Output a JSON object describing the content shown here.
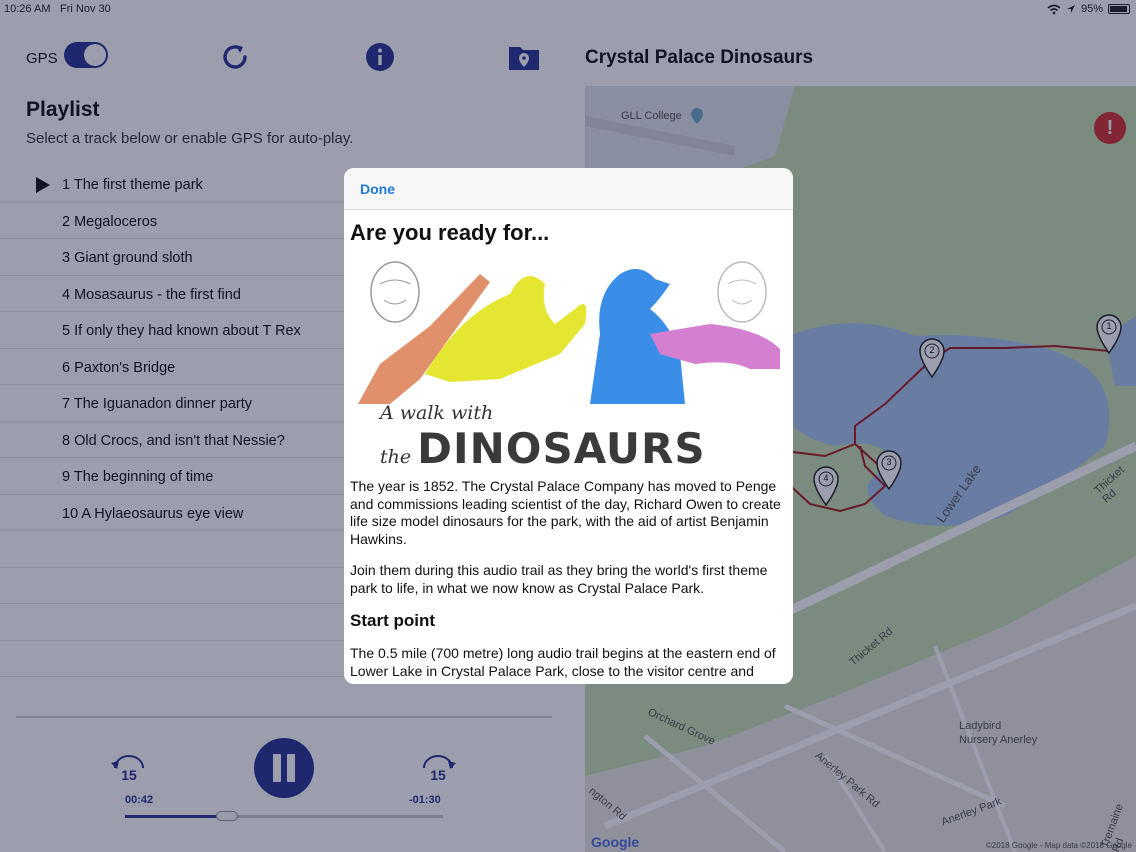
{
  "status": {
    "time": "10:26 AM",
    "date": "Fri Nov 30",
    "battery": "95%"
  },
  "left": {
    "gps_label": "GPS",
    "playlist_title": "Playlist",
    "playlist_subtitle": "Select a track below or enable GPS for auto-play.",
    "tracks": [
      "1 The first theme park",
      "2 Megaloceros",
      "3 Giant ground sloth",
      "4 Mosasaurus - the first find",
      "5 If only they had known about T Rex",
      "6 Paxton's Bridge",
      "7 The Iguanadon dinner party",
      "8 Old Crocs, and isn't that Nessie?",
      "9 The beginning of time",
      "10 A Hylaeosaurus eye view"
    ],
    "player": {
      "skip_back": "15",
      "skip_forward": "15",
      "elapsed": "00:42",
      "remaining": "-01:30",
      "progress": 0.32
    }
  },
  "right": {
    "title": "Crystal Palace Dinosaurs",
    "map_labels": {
      "college": "GLL College",
      "lake": "Lower Lake",
      "thicket_rd": "Thicket Rd",
      "thicket_rd2": "Thicket Rd",
      "orchard": "Orchard Grove",
      "anerley_park_rd": "Anerley Park Rd",
      "anerley_park": "Anerley Park",
      "ladybird": "Ladybird",
      "nursery": "Nursery Anerley",
      "seton_rd": "ngton Rd",
      "tremaine": "Tremaine Rd"
    },
    "map_copyright": "©2018 Google - Map data ©2018 Google",
    "map_brand": "Google",
    "markers": [
      "1",
      "2",
      "3",
      "4"
    ]
  },
  "modal": {
    "done": "Done",
    "heading": "Are you ready for...",
    "hero_small": "A walk with the",
    "hero_big": "DINOSAURS",
    "p1": "The year is 1852. The Crystal Palace Company has moved to Penge and commissions leading scientist of the day, Richard Owen to create life size model dinosaurs for the park, with the aid of artist Benjamin Hawkins.",
    "p2": "Join them during this audio trail as they bring the world's first theme park to life, in what we now know as Crystal Palace Park.",
    "h2": "Start point",
    "p3": "The 0.5 mile (700 metre) long audio trail begins at the eastern end of Lower Lake in Crystal Palace Park, close to the visitor centre and"
  },
  "colors": {
    "accent": "#283593",
    "link": "#1e7ad6",
    "alert": "#d32f2f"
  }
}
